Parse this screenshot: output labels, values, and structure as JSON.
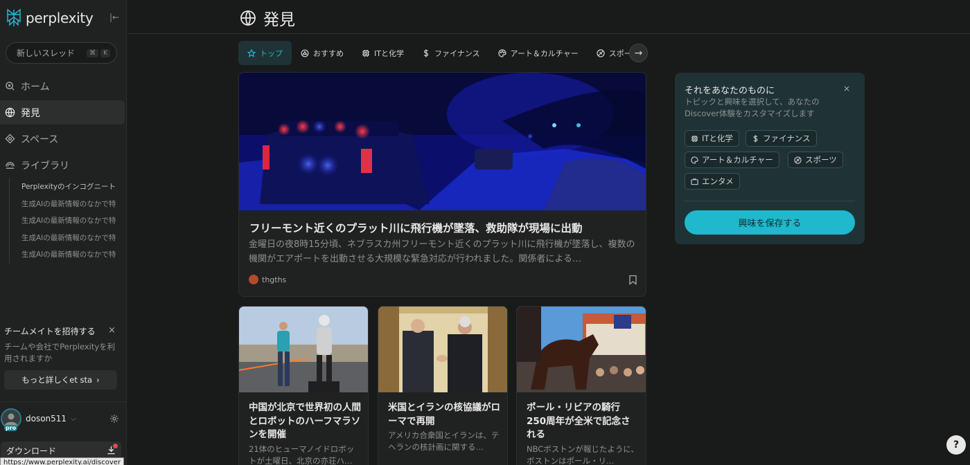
{
  "sidebar": {
    "logo_text": "perplexity",
    "new_thread": {
      "label": "新しいスレッド",
      "key1": "⌘",
      "key2": "K"
    },
    "nav": [
      {
        "label": "ホーム",
        "icon": "search-icon"
      },
      {
        "label": "発見",
        "icon": "globe-icon",
        "active": true
      },
      {
        "label": "スペース",
        "icon": "spaces-icon"
      },
      {
        "label": "ライブラリ",
        "icon": "library-icon"
      }
    ],
    "library_items": [
      "Perplexityのインコグニート",
      "生成AIの最新情報のなかで特",
      "生成AIの最新情報のなかで特",
      "生成AIの最新情報のなかで特",
      "生成AIの最新情報のなかで特"
    ],
    "invite": {
      "title": "チームメイトを招待する",
      "close": "×",
      "desc": "チームや会社でPerplexityを利用されますか",
      "button": "もっと詳しくet sta",
      "button_chevron": "›"
    },
    "user": {
      "name": "doson511",
      "badge": "pro",
      "chevron": "⌵"
    },
    "download_label": "ダウンロード",
    "url_tooltip": "https://www.perplexity.ai/discover"
  },
  "header": {
    "title": "発見"
  },
  "tabs": [
    {
      "label": "トップ",
      "icon": "star-icon",
      "active": true
    },
    {
      "label": "おすすめ",
      "icon": "sparkle-icon"
    },
    {
      "label": "ITと化学",
      "icon": "chip-icon"
    },
    {
      "label": "ファイナンス",
      "icon": "dollar-icon"
    },
    {
      "label": "アート＆カルチャー",
      "icon": "palette-icon"
    },
    {
      "label": "スポーツ",
      "icon": "ball-icon"
    }
  ],
  "tabs_next": "→",
  "hero": {
    "title": "フリーモント近くのプラット川に飛行機が墜落、救助隊が現場に出動",
    "desc": "金曜日の夜8時15分頃、ネブラスカ州フリーモント近くのプラット川に飛行機が墜落し、複数の機関がエアポートを出動させる大規模な緊急対応が行われました。関係者による…",
    "source": "thgths"
  },
  "cards": [
    {
      "title": "中国が北京で世界初の人間とロボットのハーフマラソンを開催",
      "desc": "21体のヒューマノイドロボットが土曜日、北京の亦荘ハ…"
    },
    {
      "title": "米国とイランの核協議がローマで再開",
      "desc": "アメリカ合衆国とイランは、テヘランの核計画に関する…"
    },
    {
      "title": "ポール・リビアの騎行250周年が全米で記念される",
      "desc": "NBCボストンが報じたように、ボストンはポール・リ…"
    }
  ],
  "personalize": {
    "title": "それをあなたのものに",
    "close": "×",
    "desc": "トピックと興味を選択して、あなたのDiscover体験をカスタマイズします",
    "chips": [
      {
        "label": "ITと化学",
        "icon": "chip-icon"
      },
      {
        "label": "ファイナンス",
        "icon": "dollar-icon"
      },
      {
        "label": "アート＆カルチャー",
        "icon": "palette-icon"
      },
      {
        "label": "スポーツ",
        "icon": "ball-icon"
      },
      {
        "label": "エンタメ",
        "icon": "tv-icon"
      }
    ],
    "save_label": "興味を保存する"
  },
  "help_label": "?",
  "colors": {
    "accent": "#20b8cd",
    "background": "#191a1a",
    "panel": "#1f3336"
  }
}
